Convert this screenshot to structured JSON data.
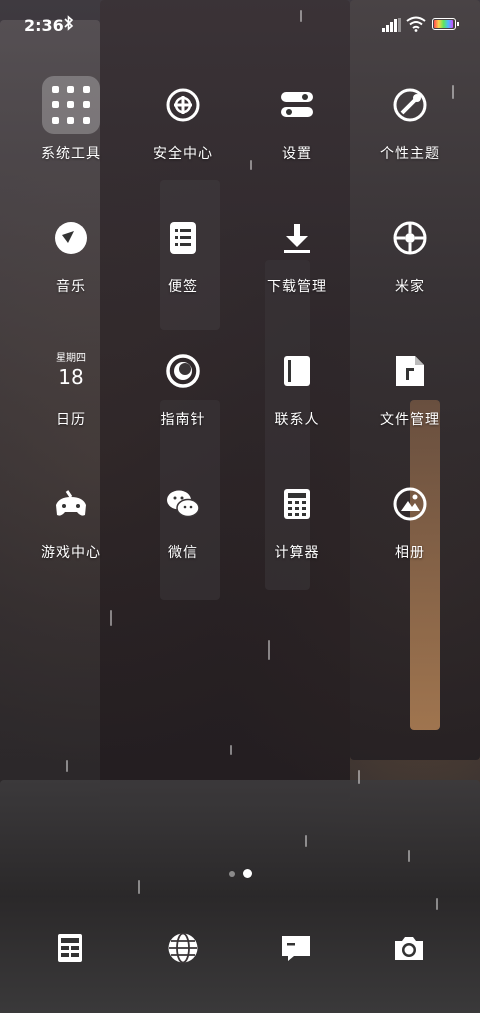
{
  "status_bar": {
    "time": "2:36"
  },
  "apps": [
    {
      "label": "系统工具",
      "icon": "folder-icon"
    },
    {
      "label": "安全中心",
      "icon": "security-icon"
    },
    {
      "label": "设置",
      "icon": "settings-icon"
    },
    {
      "label": "个性主题",
      "icon": "theme-icon"
    },
    {
      "label": "音乐",
      "icon": "music-icon"
    },
    {
      "label": "便签",
      "icon": "notes-icon"
    },
    {
      "label": "下载管理",
      "icon": "download-icon"
    },
    {
      "label": "米家",
      "icon": "mijia-icon"
    },
    {
      "label": "日历",
      "icon": "calendar-icon",
      "weekday": "星期四",
      "day": "18"
    },
    {
      "label": "指南针",
      "icon": "compass-icon"
    },
    {
      "label": "联系人",
      "icon": "contacts-icon"
    },
    {
      "label": "文件管理",
      "icon": "file-manager-icon"
    },
    {
      "label": "游戏中心",
      "icon": "gamepad-icon"
    },
    {
      "label": "微信",
      "icon": "wechat-icon"
    },
    {
      "label": "计算器",
      "icon": "calculator-icon"
    },
    {
      "label": "相册",
      "icon": "gallery-icon"
    }
  ],
  "page_indicator": {
    "pages": 2,
    "current": 2
  },
  "dock": [
    {
      "name": "phone-app",
      "icon": "phone-icon"
    },
    {
      "name": "browser-app",
      "icon": "globe-icon"
    },
    {
      "name": "messages-app",
      "icon": "message-icon"
    },
    {
      "name": "camera-app",
      "icon": "camera-icon"
    }
  ]
}
